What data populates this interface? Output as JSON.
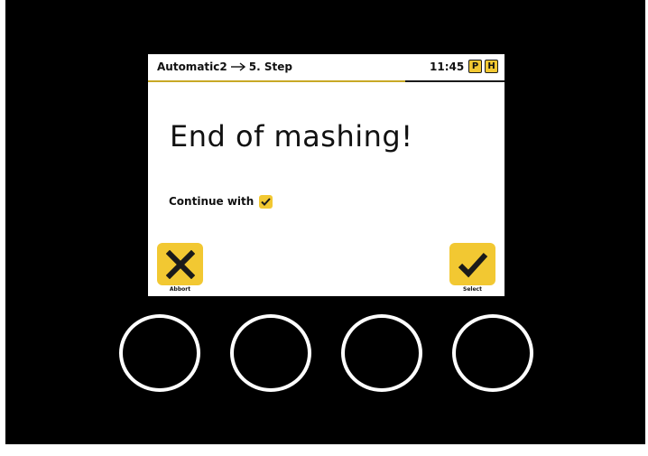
{
  "header": {
    "program": "Automatic2",
    "step": "5. Step",
    "clock": "11:45",
    "badge_p": "P",
    "badge_h": "H",
    "step_progress": 0.72
  },
  "main": {
    "message": "End of mashing!",
    "continue_label": "Continue with",
    "continue_checked": true
  },
  "softkeys": {
    "abort_label": "Abbort",
    "select_label": "Select"
  },
  "colors": {
    "accent": "#f2c832",
    "device": "#000000",
    "screen": "#ffffff"
  },
  "icons": {
    "header_arrow": "arrow-right-icon",
    "abort": "x-icon",
    "select": "checkmark-icon",
    "continue": "checkbox-checked-icon"
  }
}
